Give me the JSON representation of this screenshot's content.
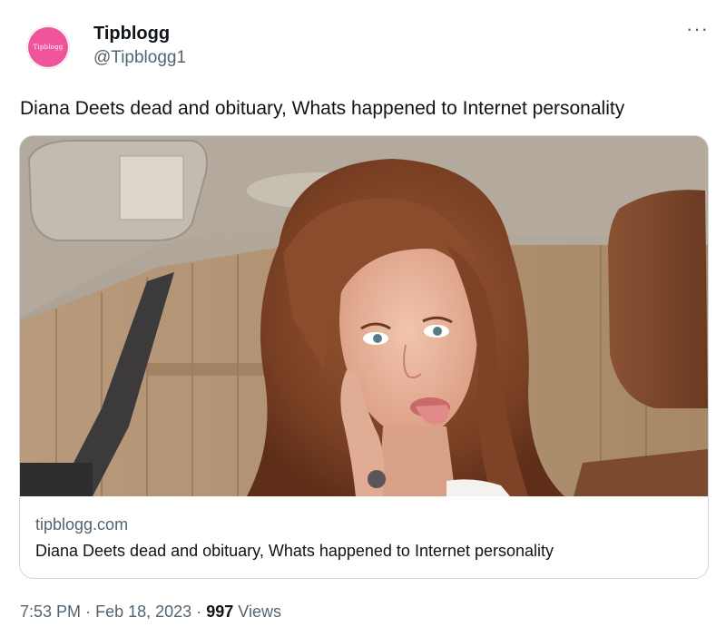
{
  "author": {
    "display_name": "Tipblogg",
    "handle": "@Tipblogg1",
    "avatar_text": "Tipblogg",
    "avatar_color": "#f0549b"
  },
  "more_menu": {
    "icon": "more-horizontal-icon",
    "label": "···"
  },
  "tweet": {
    "text": "Diana Deets dead and obituary, Whats happened to Internet personality"
  },
  "link_card": {
    "domain": "tipblogg.com",
    "title": "Diana Deets dead and obituary, Whats happened to Internet personality"
  },
  "meta": {
    "time": "7:53 PM",
    "separator": "·",
    "date": "Feb 18, 2023",
    "views_count": "997",
    "views_label": "Views"
  },
  "colors": {
    "text_primary": "#0f1419",
    "text_secondary": "#536471",
    "border": "#cfd9de"
  }
}
